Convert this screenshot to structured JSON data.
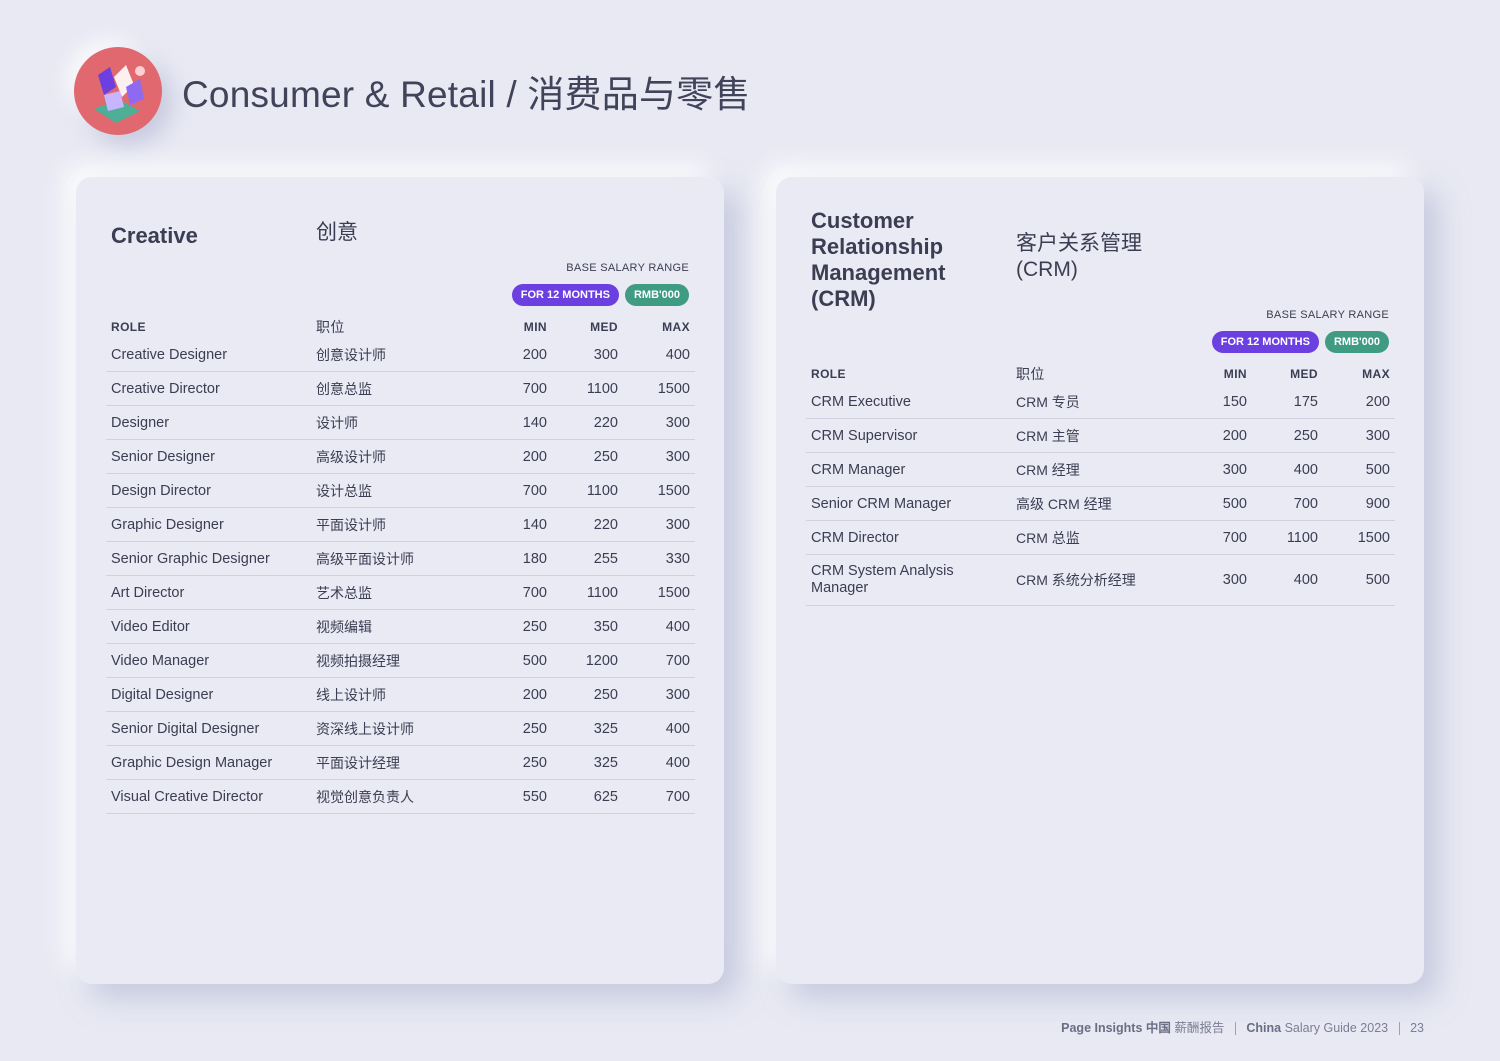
{
  "page": {
    "title": "Consumer & Retail / 消费品与零售",
    "logo_icon": "consumer-retail-illustration-icon"
  },
  "creative": {
    "title_en": "Creative",
    "title_cn": "创意",
    "salary_label": "BASE SALARY RANGE",
    "pill_months": "FOR 12 MONTHS",
    "pill_currency": "RMB'000",
    "headers": {
      "role": "ROLE",
      "cn": "职位",
      "min": "MIN",
      "med": "MED",
      "max": "MAX"
    },
    "rows": [
      {
        "role": "Creative Designer",
        "cn": "创意设计师",
        "min": "200",
        "med": "300",
        "max": "400"
      },
      {
        "role": "Creative Director",
        "cn": "创意总监",
        "min": "700",
        "med": "1100",
        "max": "1500"
      },
      {
        "role": "Designer",
        "cn": "设计师",
        "min": "140",
        "med": "220",
        "max": "300"
      },
      {
        "role": "Senior Designer",
        "cn": "高级设计师",
        "min": "200",
        "med": "250",
        "max": "300"
      },
      {
        "role": "Design Director",
        "cn": "设计总监",
        "min": "700",
        "med": "1100",
        "max": "1500"
      },
      {
        "role": "Graphic Designer",
        "cn": "平面设计师",
        "min": "140",
        "med": "220",
        "max": "300"
      },
      {
        "role": "Senior Graphic Designer",
        "cn": "高级平面设计师",
        "min": "180",
        "med": "255",
        "max": "330"
      },
      {
        "role": "Art Director",
        "cn": "艺术总监",
        "min": "700",
        "med": "1100",
        "max": "1500"
      },
      {
        "role": "Video Editor",
        "cn": "视频编辑",
        "min": "250",
        "med": "350",
        "max": "400"
      },
      {
        "role": "Video Manager",
        "cn": "视频拍摄经理",
        "min": "500",
        "med": "1200",
        "max": "700"
      },
      {
        "role": "Digital Designer",
        "cn": "线上设计师",
        "min": "200",
        "med": "250",
        "max": "300"
      },
      {
        "role": "Senior Digital Designer",
        "cn": "资深线上设计师",
        "min": "250",
        "med": "325",
        "max": "400"
      },
      {
        "role": "Graphic Design Manager",
        "cn": "平面设计经理",
        "min": "250",
        "med": "325",
        "max": "400"
      },
      {
        "role": "Visual Creative Director",
        "cn": "视觉创意负责人",
        "min": "550",
        "med": "625",
        "max": "700"
      }
    ]
  },
  "crm": {
    "title_en_lines": [
      "Customer",
      "Relationship",
      "Management",
      "(CRM)"
    ],
    "title_cn_lines": [
      "客户关系管理",
      "(CRM)"
    ],
    "salary_label": "BASE SALARY RANGE",
    "pill_months": "FOR 12 MONTHS",
    "pill_currency": "RMB'000",
    "headers": {
      "role": "ROLE",
      "cn": "职位",
      "min": "MIN",
      "med": "MED",
      "max": "MAX"
    },
    "rows": [
      {
        "role": "CRM Executive",
        "cn": "CRM 专员",
        "min": "150",
        "med": "175",
        "max": "200"
      },
      {
        "role": "CRM Supervisor",
        "cn": "CRM 主管",
        "min": "200",
        "med": "250",
        "max": "300"
      },
      {
        "role": "CRM Manager",
        "cn": "CRM 经理",
        "min": "300",
        "med": "400",
        "max": "500"
      },
      {
        "role": "Senior CRM Manager",
        "cn": "高级 CRM 经理",
        "min": "500",
        "med": "700",
        "max": "900"
      },
      {
        "role": "CRM Director",
        "cn": "CRM 总监",
        "min": "700",
        "med": "1100",
        "max": "1500"
      },
      {
        "role": "CRM System Analysis Manager",
        "cn": "CRM 系统分析经理",
        "min": "300",
        "med": "400",
        "max": "500"
      }
    ]
  },
  "footer": {
    "brand": "Page Insights 中国",
    "brand_sub": "薪酬报告",
    "guide_bold": "China",
    "guide_rest": "Salary Guide 2023",
    "page_number": "23"
  }
}
